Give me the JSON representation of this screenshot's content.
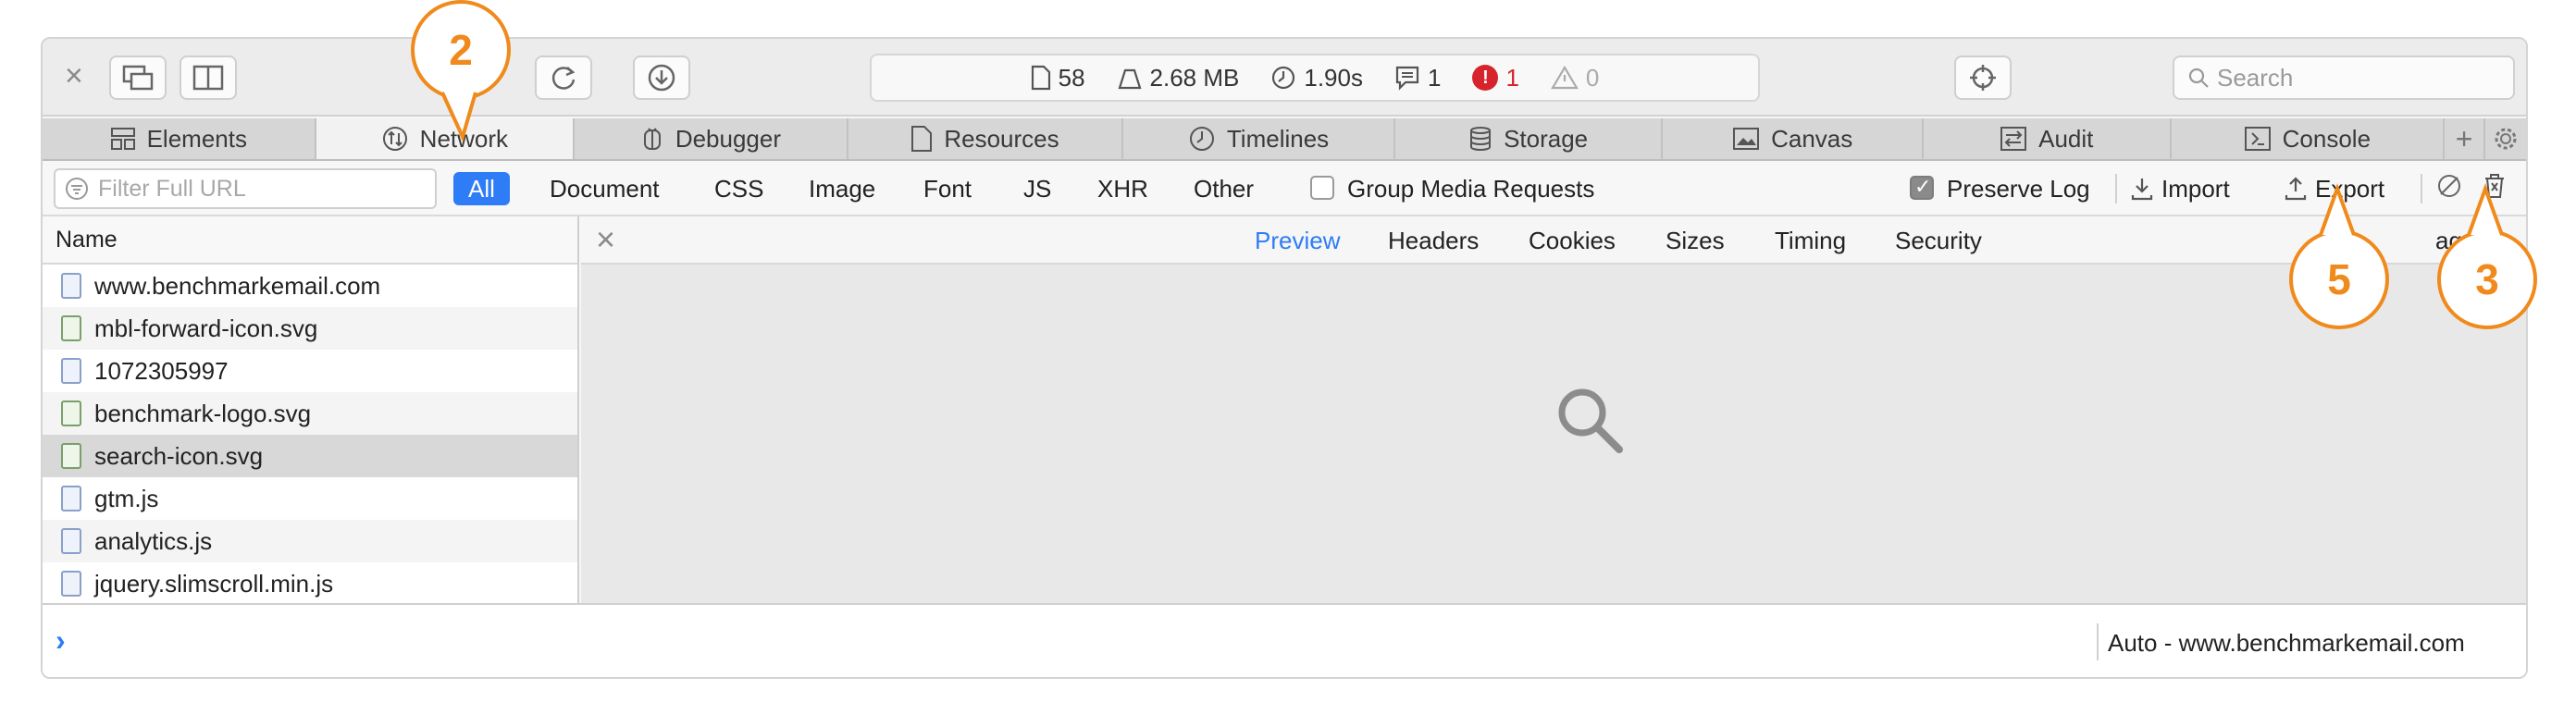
{
  "toolbar": {
    "close_label": "×",
    "activity": {
      "resources_count": "58",
      "size": "2.68 MB",
      "time": "1.90s",
      "logs": "1",
      "errors": "1",
      "warnings": "0"
    },
    "search_placeholder": "Search"
  },
  "tabs": [
    {
      "label": "Elements",
      "icon": "elements-icon"
    },
    {
      "label": "Network",
      "icon": "network-icon"
    },
    {
      "label": "Debugger",
      "icon": "debugger-icon"
    },
    {
      "label": "Resources",
      "icon": "resources-icon"
    },
    {
      "label": "Timelines",
      "icon": "timelines-icon"
    },
    {
      "label": "Storage",
      "icon": "storage-icon"
    },
    {
      "label": "Canvas",
      "icon": "canvas-icon"
    },
    {
      "label": "Audit",
      "icon": "audit-icon"
    },
    {
      "label": "Console",
      "icon": "console-icon"
    }
  ],
  "tab_extra": {
    "add_label": "+"
  },
  "filterbar": {
    "filter_placeholder": "Filter Full URL",
    "types": [
      "All",
      "Document",
      "CSS",
      "Image",
      "Font",
      "JS",
      "XHR",
      "Other"
    ],
    "group_media_label": "Group Media Requests",
    "preserve_log_label": "Preserve Log",
    "import_label": "Import",
    "export_label": "Export"
  },
  "list": {
    "header": "Name",
    "items": [
      {
        "name": "www.benchmarkemail.com",
        "kind": "document"
      },
      {
        "name": "mbl-forward-icon.svg",
        "kind": "image"
      },
      {
        "name": "1072305997",
        "kind": "script"
      },
      {
        "name": "benchmark-logo.svg",
        "kind": "image"
      },
      {
        "name": "search-icon.svg",
        "kind": "image"
      },
      {
        "name": "gtm.js",
        "kind": "script"
      },
      {
        "name": "analytics.js",
        "kind": "script"
      },
      {
        "name": "jquery.slimscroll.min.js",
        "kind": "script"
      }
    ]
  },
  "detail": {
    "tabs": [
      "Preview",
      "Headers",
      "Cookies",
      "Sizes",
      "Timing",
      "Security"
    ],
    "active_tab": "Preview",
    "trailing_label": "age"
  },
  "console": {
    "prompt": "›",
    "context": "Auto - www.benchmarkemail.com"
  },
  "callouts": [
    "2",
    "5",
    "3"
  ],
  "colors": {
    "accent": "#2e7cf6",
    "callout": "#f08a1c",
    "error": "#d7232b"
  }
}
